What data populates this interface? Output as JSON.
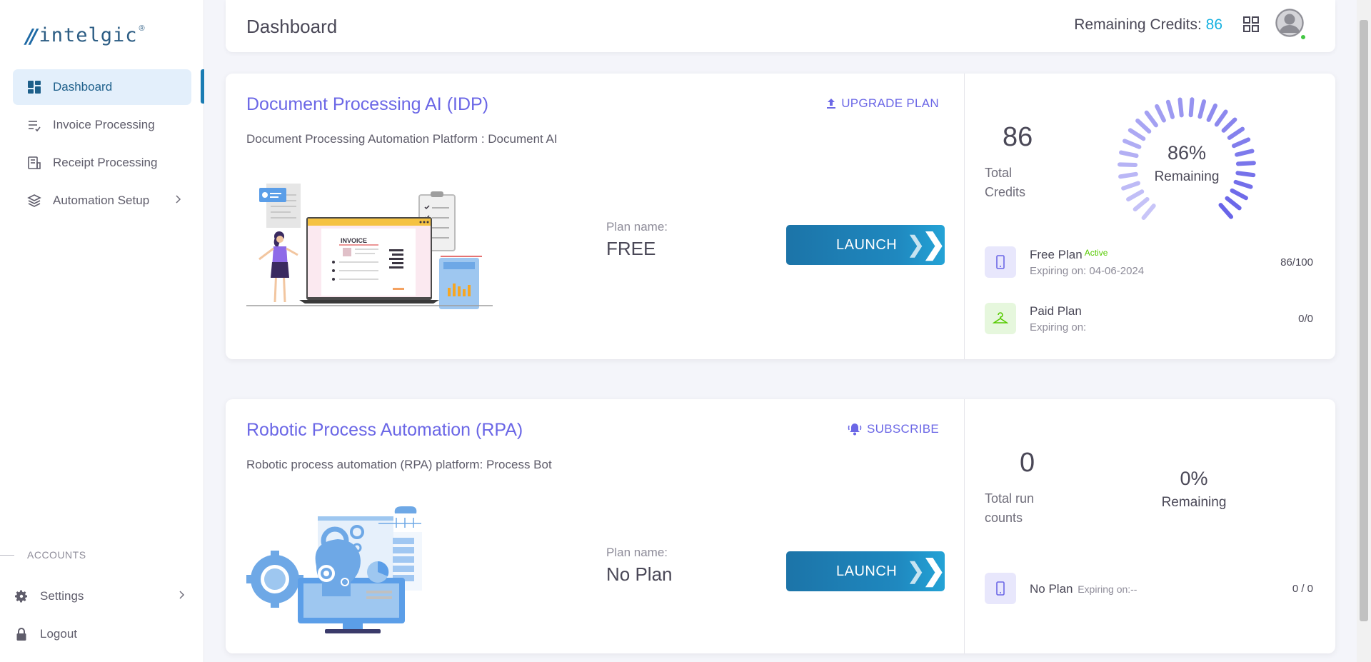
{
  "brand": {
    "slashes": "//",
    "name": "intelgic",
    "reg": "®"
  },
  "sidebar": {
    "items": [
      {
        "label": "Dashboard",
        "icon": "dashboard-icon"
      },
      {
        "label": "Invoice Processing",
        "icon": "invoice-icon"
      },
      {
        "label": "Receipt Processing",
        "icon": "receipt-icon"
      },
      {
        "label": "Automation Setup",
        "icon": "layers-icon"
      }
    ],
    "section_label": "ACCOUNTS",
    "bottom_items": [
      {
        "label": "Settings",
        "icon": "gear-icon"
      },
      {
        "label": "Logout",
        "icon": "lock-icon"
      }
    ]
  },
  "header": {
    "title": "Dashboard",
    "credits_label": "Remaining Credits:",
    "credits_value": "86"
  },
  "idp": {
    "title": "Document Processing AI (IDP)",
    "description": "Document Processing Automation Platform : Document AI",
    "action_label": "UPGRADE PLAN",
    "plan_label": "Plan name:",
    "plan_value": "FREE",
    "launch_label": "LAUNCH",
    "total_value": "86",
    "total_label_1": "Total",
    "total_label_2": "Credits",
    "percent": "86%",
    "percent_label": "Remaining",
    "remaining_fraction": 0.86,
    "plans": [
      {
        "name": "Free Plan",
        "badge": "Active",
        "expiry": "Expiring on: 04-06-2024",
        "count": "86/100"
      },
      {
        "name": "Paid Plan",
        "expiry": "Expiring on:",
        "count": "0/0"
      }
    ]
  },
  "rpa": {
    "title": "Robotic Process Automation (RPA)",
    "description": "Robotic process automation (RPA) platform: Process Bot",
    "action_label": "SUBSCRIBE",
    "plan_label": "Plan name:",
    "plan_value": "No Plan",
    "launch_label": "LAUNCH",
    "total_value": "0",
    "total_label_1": "Total run",
    "total_label_2": "counts",
    "percent": "0%",
    "percent_label": "Remaining",
    "plan": {
      "name": "No Plan",
      "expiry": "Expiring on:--",
      "count": "0 / 0"
    }
  },
  "colors": {
    "accent": "#6b67e6",
    "brand": "#1f6aa5",
    "credits": "#16b1e0",
    "active": "#56ca00"
  }
}
